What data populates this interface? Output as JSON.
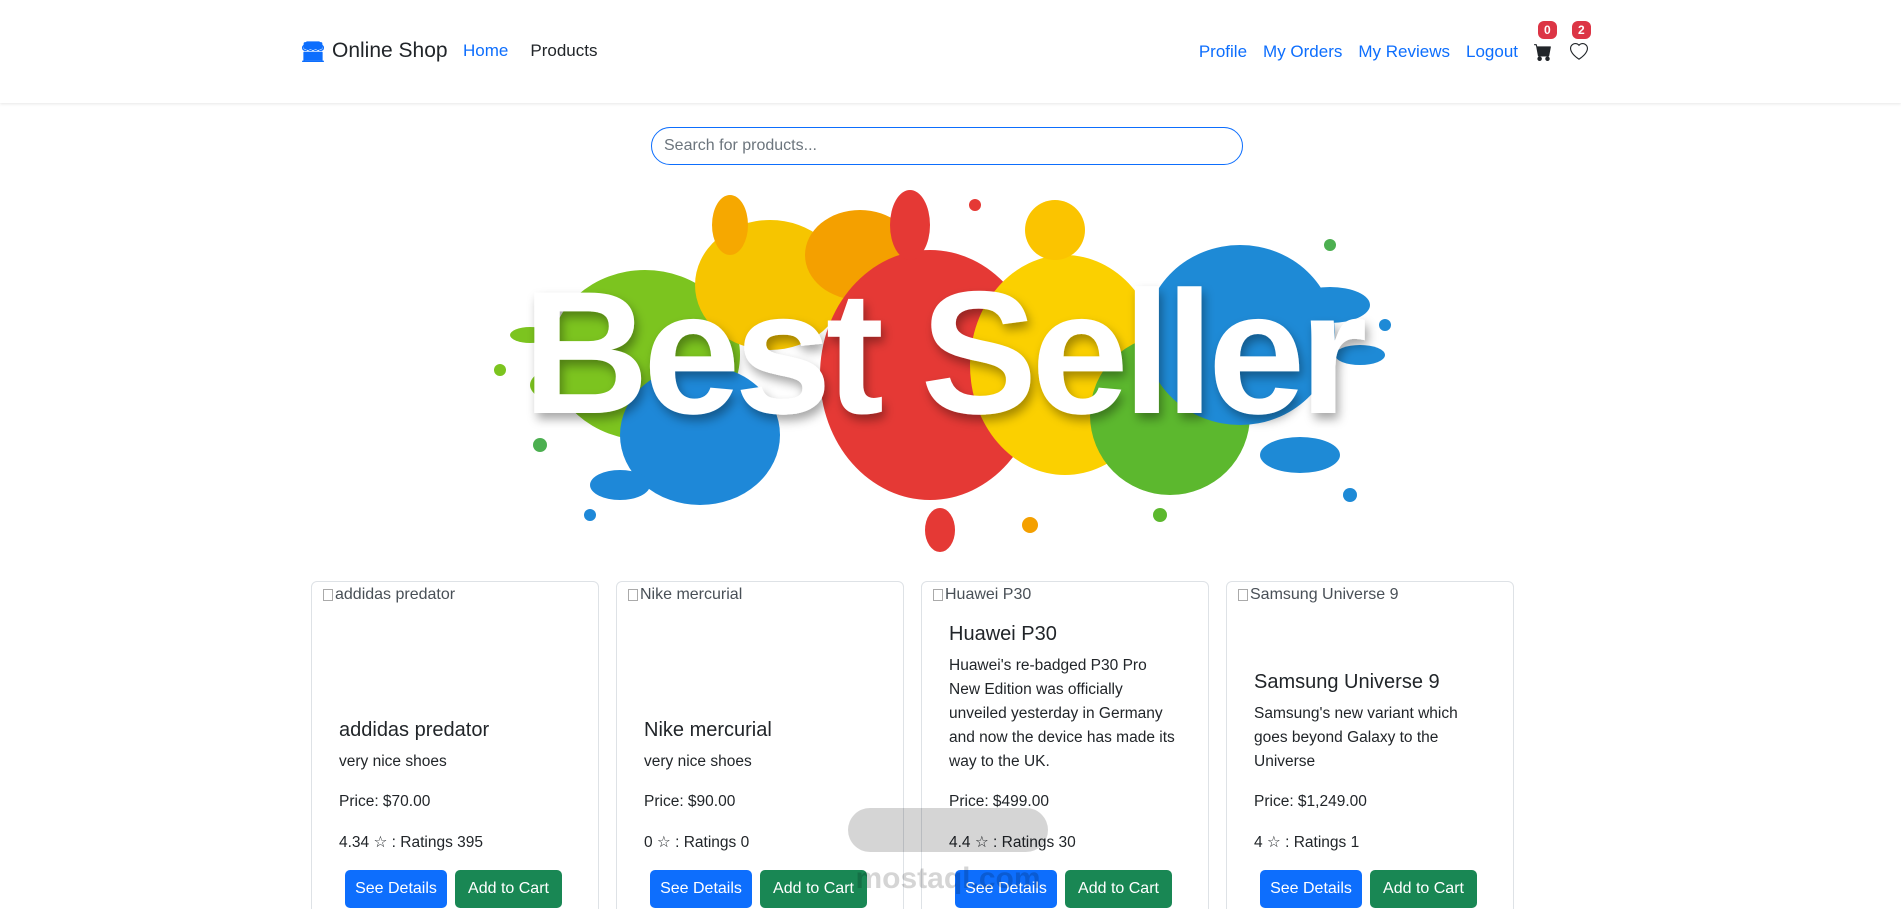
{
  "brand": {
    "name": "Online Shop",
    "icon": "shop-icon",
    "color": "#0d6efd"
  },
  "nav": {
    "left": [
      {
        "label": "Home",
        "active": true
      },
      {
        "label": "Products",
        "active": false
      }
    ],
    "right": [
      {
        "label": "Profile"
      },
      {
        "label": "My Orders"
      },
      {
        "label": "My Reviews"
      },
      {
        "label": "Logout"
      }
    ],
    "cart": {
      "icon": "cart-icon",
      "count": "0"
    },
    "wishlist": {
      "icon": "heart-icon",
      "count": "2"
    }
  },
  "search": {
    "placeholder": "Search for products...",
    "value": ""
  },
  "banner": {
    "text": "Best Seller"
  },
  "products": [
    {
      "image_alt": "addidas predator",
      "title": "addidas predator",
      "description": "very nice shoes",
      "price": "Price: $70.00",
      "rating": "4.34 ☆ : Ratings 395",
      "details_label": "See Details",
      "cart_label": "Add to Cart"
    },
    {
      "image_alt": "Nike mercurial",
      "title": "Nike mercurial",
      "description": "very nice shoes",
      "price": "Price: $90.00",
      "rating": "0 ☆ : Ratings 0",
      "details_label": "See Details",
      "cart_label": "Add to Cart"
    },
    {
      "image_alt": "Huawei P30",
      "title": "Huawei P30",
      "description": "Huawei's re-badged P30 Pro New Edition was officially unveiled yesterday in Germany and now the device has made its way to the UK.",
      "price": "Price: $499.00",
      "rating": "4.4 ☆ : Ratings 30",
      "details_label": "See Details",
      "cart_label": "Add to Cart"
    },
    {
      "image_alt": "Samsung Universe 9",
      "title": "Samsung Universe 9",
      "description": "Samsung's new variant which goes beyond Galaxy to the Universe",
      "price": "Price: $1,249.00",
      "rating": "4 ☆ : Ratings 1",
      "details_label": "See Details",
      "cart_label": "Add to Cart"
    }
  ],
  "watermark": {
    "text": "mostaql.com"
  },
  "colors": {
    "primary": "#0d6efd",
    "success": "#198754",
    "danger": "#dc3545"
  }
}
